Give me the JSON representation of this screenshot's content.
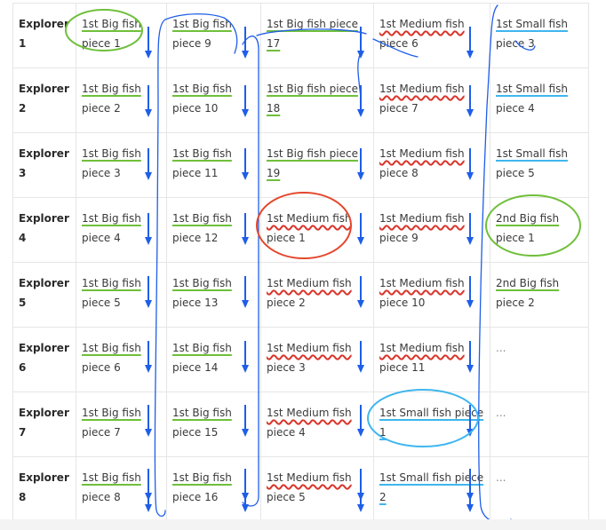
{
  "colors": {
    "big_fish": "#6fbf3a",
    "medium_fish": "#d9352b",
    "small_fish": "#3fb6ee",
    "arrows": "#1e5ee8",
    "circle_green": "#6fbf3a",
    "circle_red": "#e4472c",
    "circle_blue": "#3fb6ee"
  },
  "rows": [
    {
      "label": "Explorer 1",
      "cells": [
        {
          "fish": "1st Big fish",
          "piece": "piece 1",
          "type": "big"
        },
        {
          "fish": "1st Big fish",
          "piece": "piece 9",
          "type": "big"
        },
        {
          "fish": "1st Big fish piece 17",
          "piece": "",
          "type": "big"
        },
        {
          "fish": "1st Medium fish",
          "piece": "piece 6",
          "type": "medium"
        },
        {
          "fish": "1st Small fish",
          "piece": "piece 3",
          "type": "small"
        }
      ]
    },
    {
      "label": "Explorer 2",
      "cells": [
        {
          "fish": "1st Big fish",
          "piece": "piece 2",
          "type": "big"
        },
        {
          "fish": "1st Big fish",
          "piece": "piece 10",
          "type": "big"
        },
        {
          "fish": "1st Big fish piece 18",
          "piece": "",
          "type": "big"
        },
        {
          "fish": "1st Medium fish",
          "piece": "piece 7",
          "type": "medium"
        },
        {
          "fish": "1st Small fish",
          "piece": "piece 4",
          "type": "small"
        }
      ]
    },
    {
      "label": "Explorer 3",
      "cells": [
        {
          "fish": "1st Big fish",
          "piece": "piece 3",
          "type": "big"
        },
        {
          "fish": "1st Big fish",
          "piece": "piece 11",
          "type": "big"
        },
        {
          "fish": "1st Big fish piece 19",
          "piece": "",
          "type": "big"
        },
        {
          "fish": "1st Medium fish",
          "piece": "piece 8",
          "type": "medium"
        },
        {
          "fish": "1st Small fish",
          "piece": "piece 5",
          "type": "small"
        }
      ]
    },
    {
      "label": "Explorer 4",
      "cells": [
        {
          "fish": "1st Big fish",
          "piece": "piece 4",
          "type": "big"
        },
        {
          "fish": "1st Big fish",
          "piece": "piece 12",
          "type": "big"
        },
        {
          "fish": "1st Medium fish",
          "piece": "piece 1",
          "type": "medium"
        },
        {
          "fish": "1st Medium fish",
          "piece": "piece 9",
          "type": "medium"
        },
        {
          "fish": "2nd Big fish",
          "piece": "piece 1",
          "type": "big"
        }
      ]
    },
    {
      "label": "Explorer 5",
      "cells": [
        {
          "fish": "1st Big fish",
          "piece": "piece 5",
          "type": "big"
        },
        {
          "fish": "1st Big fish",
          "piece": "piece 13",
          "type": "big"
        },
        {
          "fish": "1st Medium fish",
          "piece": "piece 2",
          "type": "medium"
        },
        {
          "fish": "1st Medium fish",
          "piece": "piece 10",
          "type": "medium"
        },
        {
          "fish": "2nd Big fish",
          "piece": "piece 2",
          "type": "big"
        }
      ]
    },
    {
      "label": "Explorer 6",
      "cells": [
        {
          "fish": "1st Big fish",
          "piece": "piece 6",
          "type": "big"
        },
        {
          "fish": "1st Big fish",
          "piece": "piece 14",
          "type": "big"
        },
        {
          "fish": "1st Medium fish",
          "piece": "piece 3",
          "type": "medium"
        },
        {
          "fish": "1st Medium fish",
          "piece": "piece 11",
          "type": "medium"
        },
        {
          "fish": "...",
          "piece": "",
          "type": "none"
        }
      ]
    },
    {
      "label": "Explorer 7",
      "cells": [
        {
          "fish": "1st Big fish",
          "piece": "piece 7",
          "type": "big"
        },
        {
          "fish": "1st Big fish",
          "piece": "piece 15",
          "type": "big"
        },
        {
          "fish": "1st Medium fish",
          "piece": "piece 4",
          "type": "medium"
        },
        {
          "fish": "1st Small fish piece 1",
          "piece": "",
          "type": "small"
        },
        {
          "fish": "...",
          "piece": "",
          "type": "none"
        }
      ]
    },
    {
      "label": "Explorer 8",
      "cells": [
        {
          "fish": "1st Big fish",
          "piece": "piece 8",
          "type": "big"
        },
        {
          "fish": "1st Big fish",
          "piece": "piece 16",
          "type": "big"
        },
        {
          "fish": "1st Medium fish",
          "piece": "piece 5",
          "type": "medium"
        },
        {
          "fish": "1st Small fish piece 2",
          "piece": "",
          "type": "small"
        },
        {
          "fish": "...",
          "piece": "",
          "type": "none"
        }
      ]
    }
  ]
}
